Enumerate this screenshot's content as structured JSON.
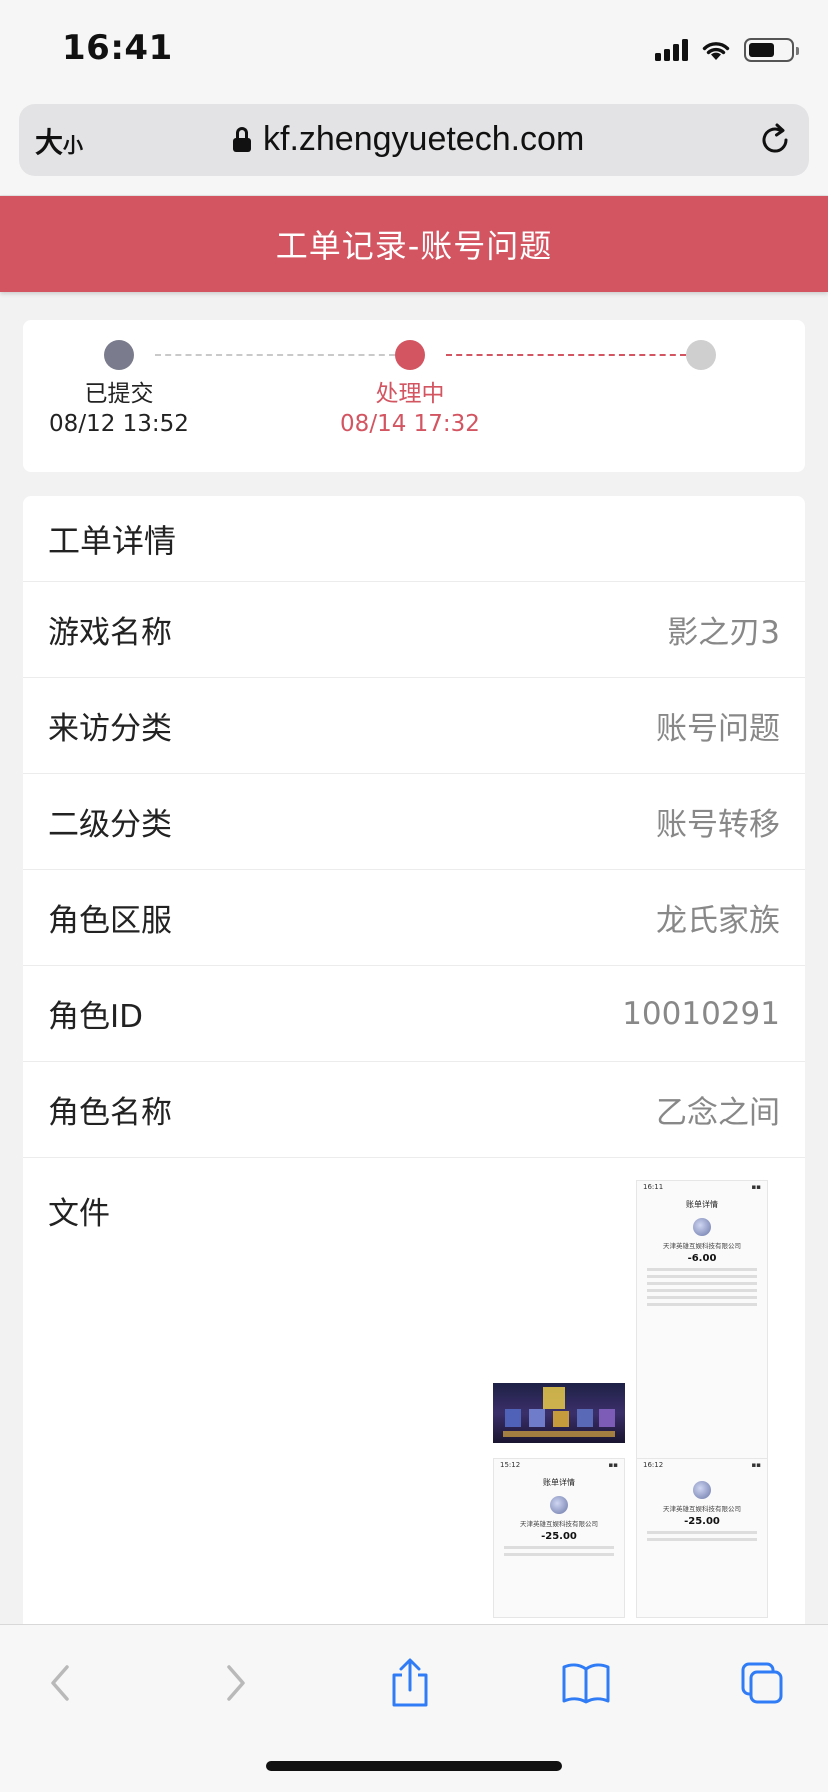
{
  "status_bar": {
    "time": "16:41",
    "battery_level": 0.62
  },
  "browser": {
    "text_size_label": "大",
    "text_size_small": "小",
    "url": "kf.zhengyuetech.com"
  },
  "header": {
    "title": "工单记录-账号问题"
  },
  "progress": {
    "steps": [
      {
        "label": "已提交",
        "time": "08/12 13:52",
        "state": "done"
      },
      {
        "label": "处理中",
        "time": "08/14 17:32",
        "state": "active"
      },
      {
        "label": "",
        "time": "",
        "state": "pending"
      }
    ]
  },
  "details": {
    "title": "工单详情",
    "rows": [
      {
        "label": "游戏名称",
        "value": "影之刃3"
      },
      {
        "label": "来访分类",
        "value": "账号问题"
      },
      {
        "label": "二级分类",
        "value": "账号转移"
      },
      {
        "label": "角色区服",
        "value": "龙氏家族"
      },
      {
        "label": "角色ID",
        "value": "10010291"
      },
      {
        "label": "角色名称",
        "value": "乙念之间"
      }
    ],
    "files_label": "文件",
    "files": [
      {
        "kind": "receipt",
        "time": "16:11",
        "title": "账单详情",
        "company": "天津英雄互娱科技有限公司",
        "amount": "-6.00"
      },
      {
        "kind": "game"
      },
      {
        "kind": "receipt",
        "time": "15:12",
        "title": "账单详情",
        "company": "天津英雄互娱科技有限公司",
        "amount": "-25.00"
      },
      {
        "kind": "receipt",
        "time": "16:12",
        "title": "",
        "company": "天津英雄互娱科技有限公司",
        "amount": "-25.00"
      }
    ]
  },
  "colors": {
    "accent": "#d35561",
    "done": "#7a7b8c",
    "pending": "#cfcfcf",
    "ios_blue": "#2f7cf6"
  },
  "toolbar": {
    "icons": [
      "back-icon",
      "forward-icon",
      "share-icon",
      "bookmarks-icon",
      "tabs-icon"
    ]
  }
}
